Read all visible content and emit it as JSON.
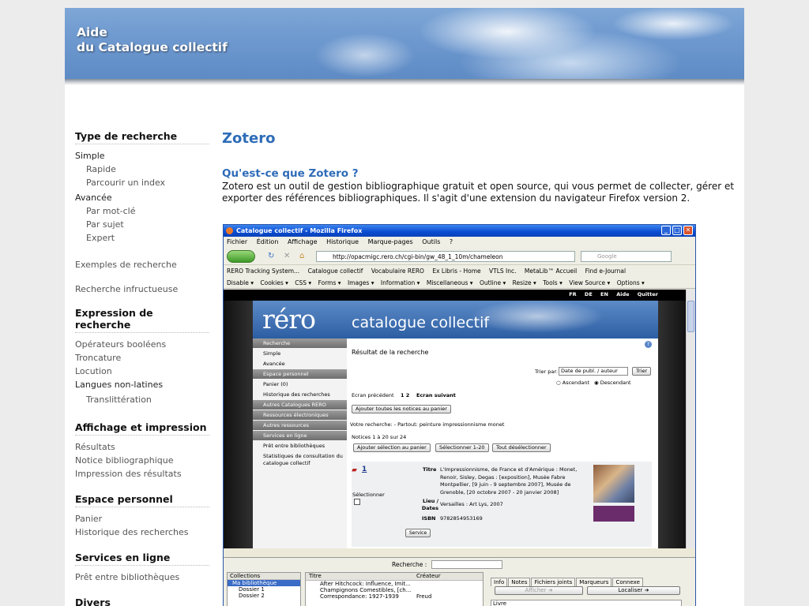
{
  "banner": {
    "title_line1": "Aide",
    "title_line2": "du Catalogue collectif"
  },
  "sidebar": {
    "sections": [
      {
        "heading": "Type de recherche"
      },
      {
        "heading": "Expression de recherche"
      },
      {
        "heading": "Affichage et impression"
      },
      {
        "heading": "Espace personnel"
      },
      {
        "heading": "Services en ligne"
      },
      {
        "heading": "Divers"
      }
    ],
    "links": {
      "simple": "Simple",
      "rapide": "Rapide",
      "parcourir": "Parcourir un index",
      "avancee": "Avancée",
      "par_mot_cle": "Par mot-clé",
      "par_sujet": "Par sujet",
      "expert": "Expert",
      "exemples": "Exemples de recherche",
      "infructueuse": "Recherche infructueuse",
      "operateurs": "Opérateurs booléens",
      "troncature": "Troncature",
      "locution": "Locution",
      "langues": "Langues non-latines",
      "translitteration": "Translittération",
      "resultats": "Résultats",
      "notice": "Notice bibliographique",
      "impression": "Impression des résultats",
      "panier": "Panier",
      "historique": "Historique des recherches",
      "pret": "Prêt entre bibliothèques"
    }
  },
  "main": {
    "title": "Zotero",
    "subtitle": "Qu'est-ce que Zotero ?",
    "paragraph": "Zotero est un outil de gestion bibliographique gratuit et open source, qui vous permet de collecter, gérer et exporter des références bibliographiques. Il s'agit d'une extension du navigateur Firefox version 2."
  },
  "screenshot": {
    "window_title": "Catalogue collectif - Mozilla Firefox",
    "menu": [
      "Fichier",
      "Édition",
      "Affichage",
      "Historique",
      "Marque-pages",
      "Outils",
      "?"
    ],
    "url": "http://opacmigc.rero.ch/cgi-bin/gw_48_1_10m/chameleon",
    "search_placeholder": "Google",
    "bookmarks": [
      "RERO Tracking System...",
      "Catalogue collectif",
      "Vocabulaire RERO",
      "Ex Libris - Home",
      "VTLS Inc.",
      "MetaLib™ Accueil",
      "Find e-Journal"
    ],
    "devbar": [
      "Disable ▾",
      "Cookies ▾",
      "CSS ▾",
      "Forms ▾",
      "Images ▾",
      "Information ▾",
      "Miscellaneous ▾",
      "Outline ▾",
      "Resize ▾",
      "Tools ▾",
      "View Source ▾",
      "Options ▾"
    ],
    "rero_links": [
      "FR",
      "DE",
      "EN",
      "Aide",
      "Quitter"
    ],
    "rero_logo": "réro",
    "rero_catalogue": "catalogue collectif",
    "rero_side": {
      "recherche": "Recherche",
      "simple": "Simple",
      "avancee": "Avancée",
      "espace": "Espace personnel",
      "panier": "Panier (0)",
      "historique": "Historique des recherches",
      "autres_catalogues": "Autres Catalogues RERO",
      "ressources_elec": "Ressources électroniques",
      "autres_ressources": "Autres ressources",
      "services": "Services en ligne",
      "pret": "Prêt entre bibliothèques",
      "stats": "Statistiques de consultation du catalogue collectif"
    },
    "rero_main": {
      "title": "Résultat de la recherche",
      "trier_par": "Trier par:",
      "trier_option": "Date de publ. / auteur",
      "trier_btn": "Trier",
      "ascendant": "Ascendant",
      "descendant": "Descendant",
      "ecran_prec": "Ecran précédent",
      "pages": "1  2",
      "ecran_suiv": "Ecran suivant",
      "ajouter_tout": "Ajouter toutes les notices au panier",
      "votre_recherche": "Votre recherche: - Partout: peinture impressionnisme monet",
      "notices": "Notices 1 à 20 sur 24",
      "ajouter_sel": "Ajouter sélection au panier",
      "selectionner": "Sélectionner 1-20",
      "deselectionner": "Tout désélectionner",
      "num": "1",
      "selectionner_label": "Sélectionner",
      "titre_label": "Titre",
      "titre_value": "L'Impressionnisme, de France et d'Amérique : Monet, Renoir, Sisley, Degas : [exposition], Musée Fabre Montpellier, [9 juin - 9 septembre 2007], Musée de Grenoble, [20 octobre 2007 - 20 janvier 2008]",
      "lieu_label": "Lieu / Dates",
      "lieu_value": "Versailles : Art Lys, 2007",
      "isbn_label": "ISBN",
      "isbn_value": "9782854953169",
      "service_btn": "Service"
    },
    "zotero": {
      "recherche": "Recherche :",
      "collections": "Collections",
      "ma_bib": "Ma bibliothèque",
      "dossier1": "Dossier 1",
      "dossier2": "Dossier 2",
      "titre_col": "Titre",
      "createur_col": "Créateur",
      "item1": "After Hitchcock: Influence, Imit...",
      "item2": "Champignons Comestibles, [ch...",
      "item3": "Correspondance: 1927-1939",
      "item3_creator": "Freud",
      "tabs": [
        "Info",
        "Notes",
        "Fichiers joints",
        "Marqueurs",
        "Connexe"
      ],
      "afficher": "Afficher ➔",
      "localiser": "Localiser ➔",
      "livre": "Livre"
    }
  }
}
